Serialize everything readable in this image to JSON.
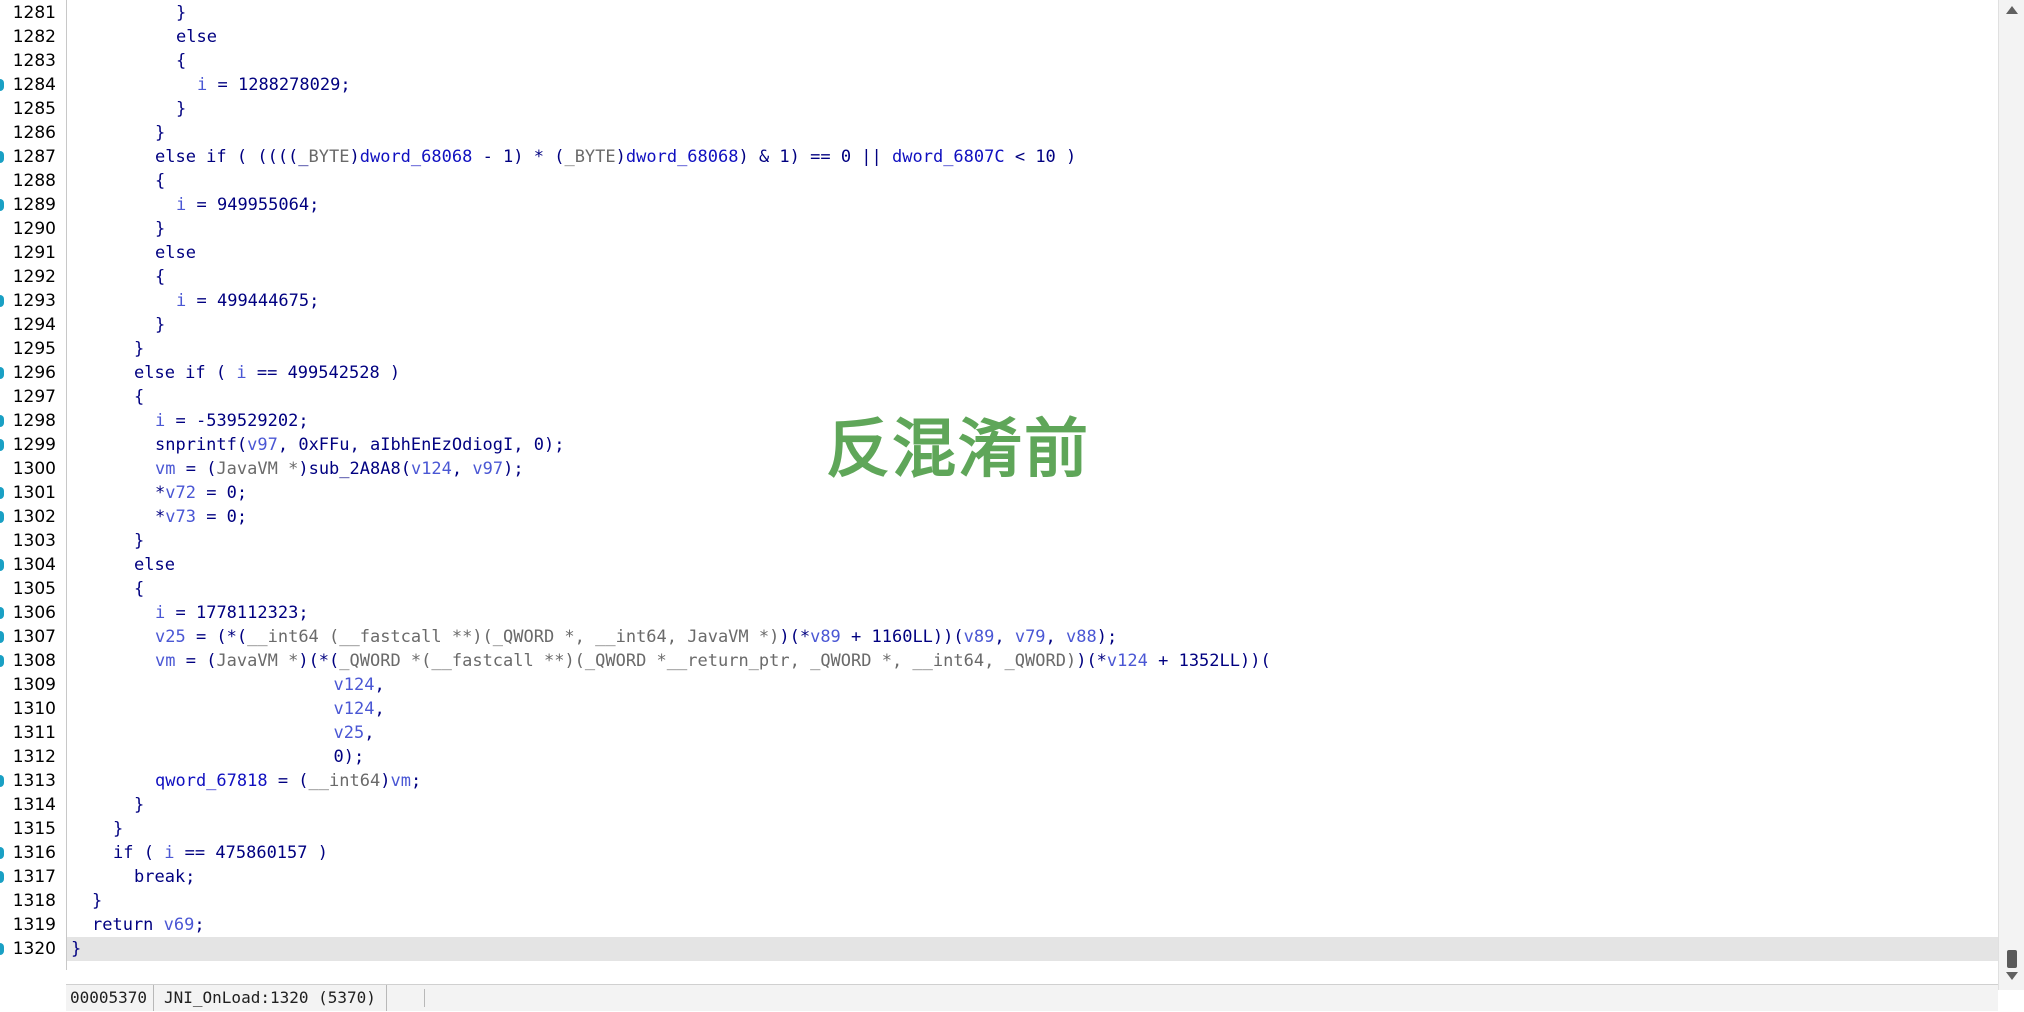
{
  "editor": {
    "watermark_text": "反混淆前",
    "current_line": 1320,
    "marked_lines": [
      1284,
      1287,
      1289,
      1293,
      1296,
      1298,
      1299,
      1301,
      1302,
      1304,
      1306,
      1307,
      1308,
      1313,
      1316,
      1317,
      1320
    ],
    "lines": [
      {
        "n": 1281,
        "indent": 10,
        "tokens": [
          [
            "t",
            "}"
          ]
        ]
      },
      {
        "n": 1282,
        "indent": 10,
        "tokens": [
          [
            "t",
            "else"
          ]
        ]
      },
      {
        "n": 1283,
        "indent": 10,
        "tokens": [
          [
            "t",
            "{"
          ]
        ]
      },
      {
        "n": 1284,
        "indent": 12,
        "tokens": [
          [
            "v",
            "i"
          ],
          [
            "t",
            " = "
          ],
          [
            "n",
            "1288278029"
          ],
          [
            "t",
            ";"
          ]
        ]
      },
      {
        "n": 1285,
        "indent": 10,
        "tokens": [
          [
            "t",
            "}"
          ]
        ]
      },
      {
        "n": 1286,
        "indent": 8,
        "tokens": [
          [
            "t",
            "}"
          ]
        ]
      },
      {
        "n": 1287,
        "indent": 8,
        "tokens": [
          [
            "t",
            "else if ( ((((_"
          ],
          [
            "y",
            "BYTE"
          ],
          [
            "t",
            ")"
          ],
          [
            "g",
            "dword_68068"
          ],
          [
            "t",
            " - 1) * ("
          ],
          [
            "y",
            "_BYTE"
          ],
          [
            "t",
            ")"
          ],
          [
            "g",
            "dword_68068"
          ],
          [
            "t",
            ") & 1) == 0 || "
          ],
          [
            "g",
            "dword_6807C"
          ],
          [
            "t",
            " < 10 )"
          ]
        ]
      },
      {
        "n": 1288,
        "indent": 8,
        "tokens": [
          [
            "t",
            "{"
          ]
        ]
      },
      {
        "n": 1289,
        "indent": 10,
        "tokens": [
          [
            "v",
            "i"
          ],
          [
            "t",
            " = "
          ],
          [
            "n",
            "949955064"
          ],
          [
            "t",
            ";"
          ]
        ]
      },
      {
        "n": 1290,
        "indent": 8,
        "tokens": [
          [
            "t",
            "}"
          ]
        ]
      },
      {
        "n": 1291,
        "indent": 8,
        "tokens": [
          [
            "t",
            "else"
          ]
        ]
      },
      {
        "n": 1292,
        "indent": 8,
        "tokens": [
          [
            "t",
            "{"
          ]
        ]
      },
      {
        "n": 1293,
        "indent": 10,
        "tokens": [
          [
            "v",
            "i"
          ],
          [
            "t",
            " = "
          ],
          [
            "n",
            "499444675"
          ],
          [
            "t",
            ";"
          ]
        ]
      },
      {
        "n": 1294,
        "indent": 8,
        "tokens": [
          [
            "t",
            "}"
          ]
        ]
      },
      {
        "n": 1295,
        "indent": 6,
        "tokens": [
          [
            "t",
            "}"
          ]
        ]
      },
      {
        "n": 1296,
        "indent": 6,
        "tokens": [
          [
            "t",
            "else if ( "
          ],
          [
            "v",
            "i"
          ],
          [
            "t",
            " == "
          ],
          [
            "n",
            "499542528"
          ],
          [
            "t",
            " )"
          ]
        ]
      },
      {
        "n": 1297,
        "indent": 6,
        "tokens": [
          [
            "t",
            "{"
          ]
        ]
      },
      {
        "n": 1298,
        "indent": 8,
        "tokens": [
          [
            "v",
            "i"
          ],
          [
            "t",
            " = "
          ],
          [
            "n",
            "-539529202"
          ],
          [
            "t",
            ";"
          ]
        ]
      },
      {
        "n": 1299,
        "indent": 8,
        "tokens": [
          [
            "f",
            "snprintf"
          ],
          [
            "t",
            "("
          ],
          [
            "v",
            "v97"
          ],
          [
            "t",
            ", 0xFFu, aIbhEnEzOdiogI, 0);"
          ]
        ]
      },
      {
        "n": 1300,
        "indent": 8,
        "tokens": [
          [
            "v",
            "vm"
          ],
          [
            "t",
            " = ("
          ],
          [
            "y",
            "JavaVM *"
          ],
          [
            "t",
            ")"
          ],
          [
            "f",
            "sub_2A8A8"
          ],
          [
            "t",
            "("
          ],
          [
            "v",
            "v124"
          ],
          [
            "t",
            ", "
          ],
          [
            "v",
            "v97"
          ],
          [
            "t",
            ");"
          ]
        ]
      },
      {
        "n": 1301,
        "indent": 8,
        "tokens": [
          [
            "t",
            "*"
          ],
          [
            "v",
            "v72"
          ],
          [
            "t",
            " = 0;"
          ]
        ]
      },
      {
        "n": 1302,
        "indent": 8,
        "tokens": [
          [
            "t",
            "*"
          ],
          [
            "v",
            "v73"
          ],
          [
            "t",
            " = 0;"
          ]
        ]
      },
      {
        "n": 1303,
        "indent": 6,
        "tokens": [
          [
            "t",
            "}"
          ]
        ]
      },
      {
        "n": 1304,
        "indent": 6,
        "tokens": [
          [
            "t",
            "else"
          ]
        ]
      },
      {
        "n": 1305,
        "indent": 6,
        "tokens": [
          [
            "t",
            "{"
          ]
        ]
      },
      {
        "n": 1306,
        "indent": 8,
        "tokens": [
          [
            "v",
            "i"
          ],
          [
            "t",
            " = "
          ],
          [
            "n",
            "1778112323"
          ],
          [
            "t",
            ";"
          ]
        ]
      },
      {
        "n": 1307,
        "indent": 8,
        "tokens": [
          [
            "v",
            "v25"
          ],
          [
            "t",
            " = (*("
          ],
          [
            "y",
            "__int64 (__fastcall **)(_QWORD *, __int64, JavaVM *)"
          ],
          [
            "t",
            ")(*"
          ],
          [
            "v",
            "v89"
          ],
          [
            "t",
            " + 1160LL))("
          ],
          [
            "v",
            "v89"
          ],
          [
            "t",
            ", "
          ],
          [
            "v",
            "v79"
          ],
          [
            "t",
            ", "
          ],
          [
            "v",
            "v88"
          ],
          [
            "t",
            ");"
          ]
        ]
      },
      {
        "n": 1308,
        "indent": 8,
        "tokens": [
          [
            "v",
            "vm"
          ],
          [
            "t",
            " = ("
          ],
          [
            "y",
            "JavaVM *"
          ],
          [
            "t",
            ")(*("
          ],
          [
            "y",
            "_QWORD *(__fastcall **)(_QWORD *__return_ptr, _QWORD *, __int64, _QWORD)"
          ],
          [
            "t",
            ")(*"
          ],
          [
            "v",
            "v124"
          ],
          [
            "t",
            " + 1352LL))("
          ]
        ]
      },
      {
        "n": 1309,
        "indent": 25,
        "tokens": [
          [
            "v",
            "v124"
          ],
          [
            "t",
            ","
          ]
        ]
      },
      {
        "n": 1310,
        "indent": 25,
        "tokens": [
          [
            "v",
            "v124"
          ],
          [
            "t",
            ","
          ]
        ]
      },
      {
        "n": 1311,
        "indent": 25,
        "tokens": [
          [
            "v",
            "v25"
          ],
          [
            "t",
            ","
          ]
        ]
      },
      {
        "n": 1312,
        "indent": 25,
        "tokens": [
          [
            "t",
            "0);"
          ]
        ]
      },
      {
        "n": 1313,
        "indent": 8,
        "tokens": [
          [
            "g",
            "qword_67818"
          ],
          [
            "t",
            " = ("
          ],
          [
            "y",
            "__int64"
          ],
          [
            "t",
            ")"
          ],
          [
            "v",
            "vm"
          ],
          [
            "t",
            ";"
          ]
        ]
      },
      {
        "n": 1314,
        "indent": 6,
        "tokens": [
          [
            "t",
            "}"
          ]
        ]
      },
      {
        "n": 1315,
        "indent": 4,
        "tokens": [
          [
            "t",
            "}"
          ]
        ]
      },
      {
        "n": 1316,
        "indent": 4,
        "tokens": [
          [
            "t",
            "if ( "
          ],
          [
            "v",
            "i"
          ],
          [
            "t",
            " == "
          ],
          [
            "n",
            "475860157"
          ],
          [
            "t",
            " )"
          ]
        ]
      },
      {
        "n": 1317,
        "indent": 6,
        "tokens": [
          [
            "t",
            "break;"
          ]
        ]
      },
      {
        "n": 1318,
        "indent": 2,
        "tokens": [
          [
            "t",
            "}"
          ]
        ]
      },
      {
        "n": 1319,
        "indent": 2,
        "tokens": [
          [
            "t",
            "return "
          ],
          [
            "v",
            "v69"
          ],
          [
            "t",
            ";"
          ]
        ]
      },
      {
        "n": 1320,
        "indent": 0,
        "tokens": [
          [
            "t",
            "}"
          ]
        ]
      }
    ]
  },
  "status_bar": {
    "address": "00005370",
    "location": "JNI_OnLoad:1320 (5370)"
  },
  "colors": {
    "variable": "#4a57d4",
    "text": "#000080",
    "type": "#6a6a6a",
    "global": "#1010c0",
    "gutter_marker": "#1aa0c4",
    "current_line_bg": "#e4e4e4",
    "watermark": "#5fa659"
  },
  "icons": {
    "scroll_up": "scroll-up-arrow-icon",
    "scroll_down": "scroll-down-arrow-icon",
    "line_marker": "breakpoint-marker-icon"
  }
}
